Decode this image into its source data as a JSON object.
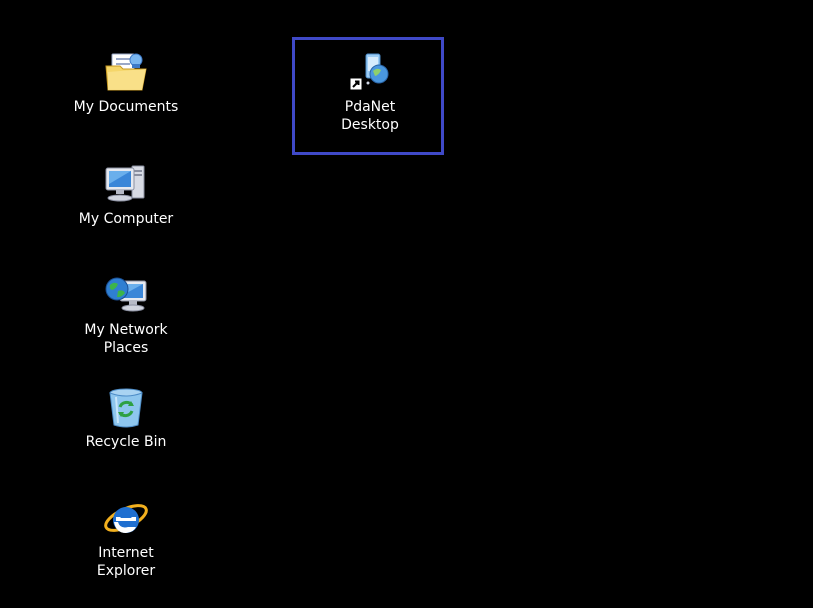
{
  "desktop": {
    "background": "#000000",
    "selection_color": "#3f49c7",
    "selected_icon": "PdaNet Desktop",
    "icons": {
      "my_documents": {
        "line1": "My Documents",
        "line2": "",
        "icon": "folder-documents-icon"
      },
      "my_computer": {
        "line1": "My Computer",
        "line2": "",
        "icon": "computer-icon"
      },
      "my_network": {
        "line1": "My Network",
        "line2": "Places",
        "icon": "network-places-icon"
      },
      "recycle_bin": {
        "line1": "Recycle Bin",
        "line2": "",
        "icon": "recycle-bin-icon"
      },
      "ie": {
        "line1": "Internet",
        "line2": "Explorer",
        "icon": "internet-explorer-icon"
      },
      "pdanet": {
        "line1": "PdaNet",
        "line2": "Desktop",
        "icon": "pdanet-shortcut-icon"
      }
    }
  }
}
